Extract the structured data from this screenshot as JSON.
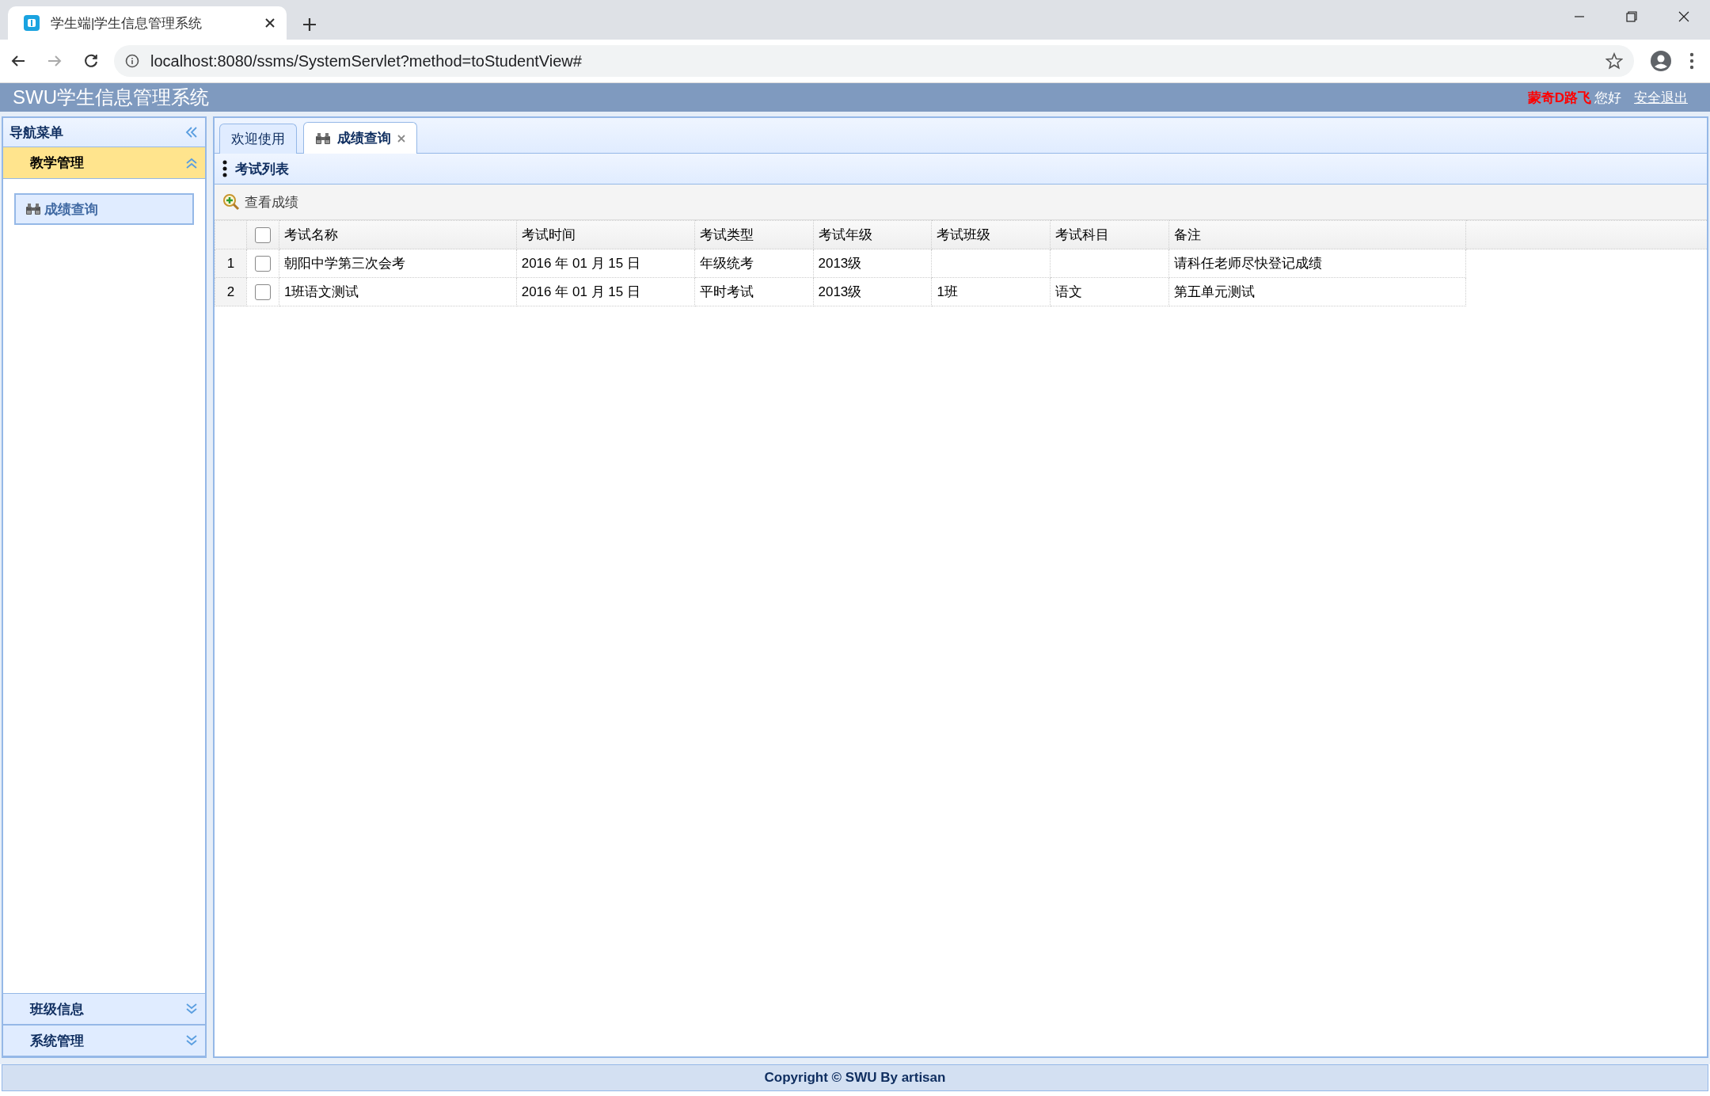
{
  "browser": {
    "tab_title": "学生端|学生信息管理系统",
    "url": "localhost:8080/ssms/SystemServlet?method=toStudentView#"
  },
  "header": {
    "title": "SWU学生信息管理系统",
    "user_name": "蒙奇D路飞",
    "greeting": "您好",
    "logout": "安全退出"
  },
  "sidebar": {
    "title": "导航菜单",
    "sections": [
      {
        "label": "教学管理",
        "expanded": true,
        "items": [
          {
            "label": "成绩查询",
            "selected": true
          }
        ]
      },
      {
        "label": "班级信息",
        "expanded": false
      },
      {
        "label": "系统管理",
        "expanded": false
      }
    ]
  },
  "tabs": [
    {
      "label": "欢迎使用",
      "selected": false,
      "closable": false
    },
    {
      "label": "成绩查询",
      "selected": true,
      "closable": true
    }
  ],
  "panel": {
    "title": "考试列表",
    "toolbar": [
      "查看成绩"
    ],
    "table": {
      "select_all_checked": false,
      "columns": [
        "考试名称",
        "考试时间",
        "考试类型",
        "考试年级",
        "考试班级",
        "考试科目",
        "备注"
      ],
      "rows": [
        {
          "number": "1",
          "checked": false,
          "cells": [
            "朝阳中学第三次会考",
            "2016 年 01 月 15 日",
            "年级统考",
            "2013级",
            "",
            "",
            "请科任老师尽快登记成绩"
          ]
        },
        {
          "number": "2",
          "checked": false,
          "cells": [
            "1班语文测试",
            "2016 年 01 月 15 日",
            "平时考试",
            "2013级",
            "1班",
            "语文",
            "第五单元测试"
          ]
        }
      ]
    }
  },
  "footer": "Copyright © SWU By artisan"
}
